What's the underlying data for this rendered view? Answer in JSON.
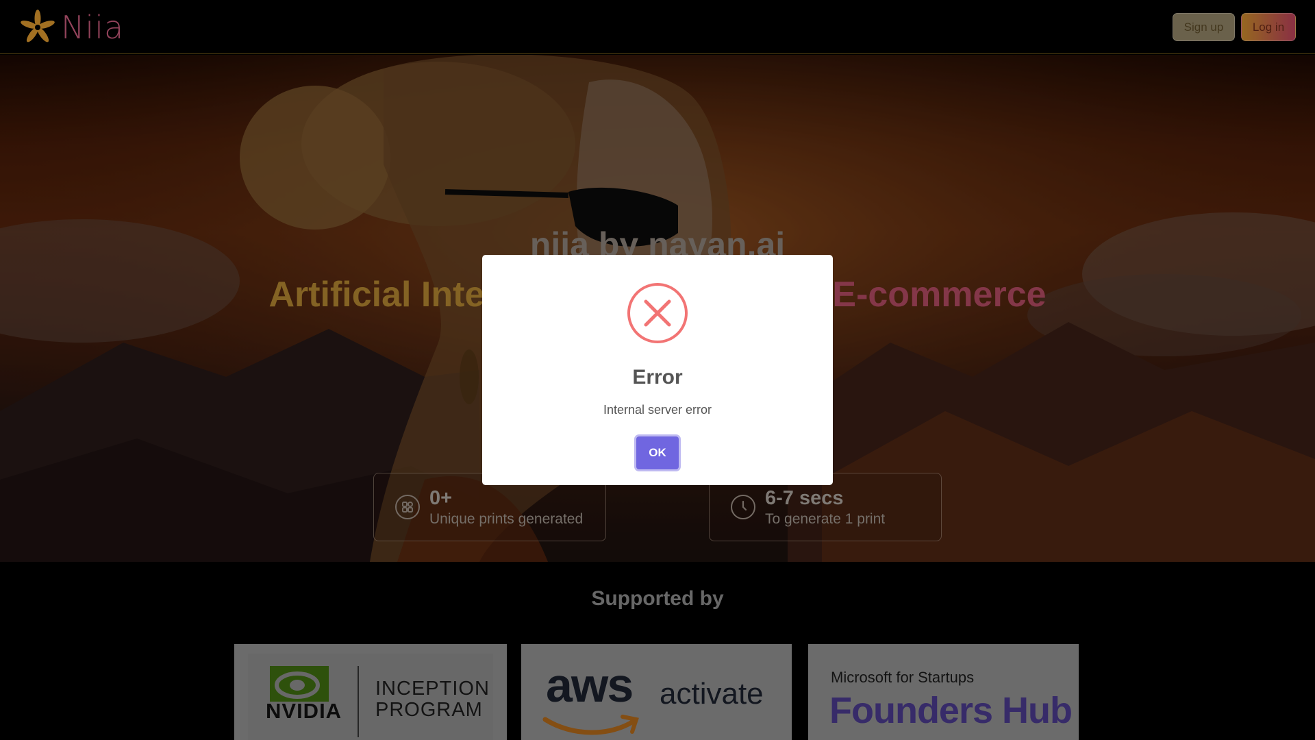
{
  "header": {
    "logo_text": "Niia",
    "signup_label": "Sign up",
    "login_label": "Log in"
  },
  "hero": {
    "title": "niia by nayan.ai",
    "tagline_left": "Artificial Inte",
    "tagline_right": "E-commerce",
    "stats": [
      {
        "value": "0+",
        "label": "Unique prints generated",
        "icon": "grid-icon"
      },
      {
        "value": "6-7 secs",
        "label": "To generate 1 print",
        "icon": "clock-icon"
      }
    ]
  },
  "supported": {
    "title": "Supported by",
    "partners": [
      {
        "brand": "NVIDIA",
        "program_line1": "INCEPTION",
        "program_line2": "PROGRAM"
      },
      {
        "brand": "aws",
        "sub": "activate"
      },
      {
        "small": "Microsoft for Startups",
        "big": "Founders Hub"
      }
    ]
  },
  "modal": {
    "icon": "error-x-icon",
    "title": "Error",
    "message": "Internal server error",
    "ok_label": "OK"
  },
  "colors": {
    "error_red": "#f27474",
    "ok_button": "#7066e0",
    "brand_pink": "#c45a7a",
    "brand_gold": "#d9962e"
  }
}
